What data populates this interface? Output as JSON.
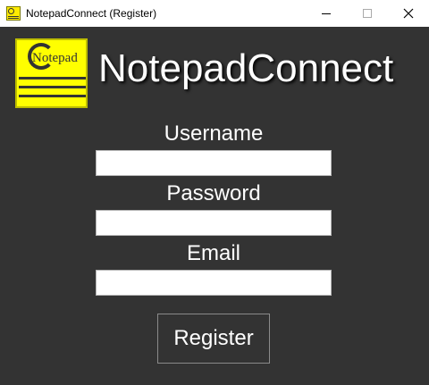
{
  "window": {
    "title": "NotepadConnect (Register)",
    "controls": {
      "minimize": "minimize",
      "maximize": "maximize",
      "close": "close"
    }
  },
  "logo": {
    "word": "Notepad",
    "initial": "C"
  },
  "app_title": "NotepadConnect",
  "form": {
    "username": {
      "label": "Username",
      "value": "",
      "placeholder": ""
    },
    "password": {
      "label": "Password",
      "value": "",
      "placeholder": ""
    },
    "email": {
      "label": "Email",
      "value": "",
      "placeholder": ""
    },
    "submit_label": "Register"
  },
  "colors": {
    "background": "#333333",
    "logo_yellow": "#ffff00",
    "text": "#ffffff"
  }
}
